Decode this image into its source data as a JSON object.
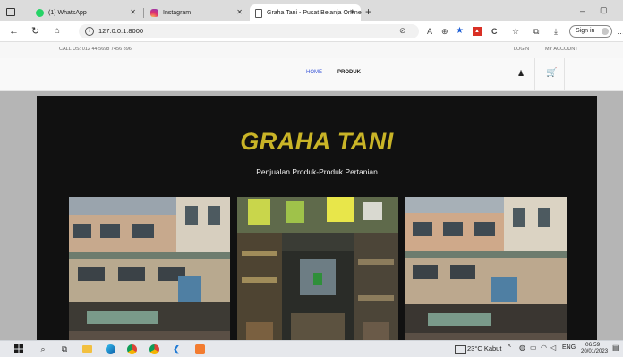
{
  "browser": {
    "tabs": [
      {
        "label": "(1) WhatsApp",
        "icon": "whatsapp-icon",
        "color": "#25d366"
      },
      {
        "label": "Instagram",
        "icon": "instagram-icon",
        "color": "#e1306c"
      },
      {
        "label": "Graha Tani - Pusat Belanja Online",
        "icon": "page-icon",
        "color": "#555555"
      }
    ],
    "new_tab": "+",
    "url": "127.0.0.1:8000",
    "sign_in": "Sign in",
    "window_controls": {
      "minimize": "–",
      "maximize": "▢"
    }
  },
  "site": {
    "contact": "CALL US: 012 44 5698 7456 896",
    "login": "LOGIN",
    "my_account": "MY ACCOUNT",
    "nav": {
      "home": "HOME",
      "produk": "PRODUK"
    },
    "accent": "#3a56d8",
    "hero": {
      "title": "GRAHA TANI",
      "subtitle": "Penjualan Produk-Produk Pertanian",
      "title_color": "#c9b427"
    }
  },
  "taskbar": {
    "weather": "23°C Kabut",
    "language": "ENG",
    "time": "06.59",
    "date": "20/01/2023"
  }
}
